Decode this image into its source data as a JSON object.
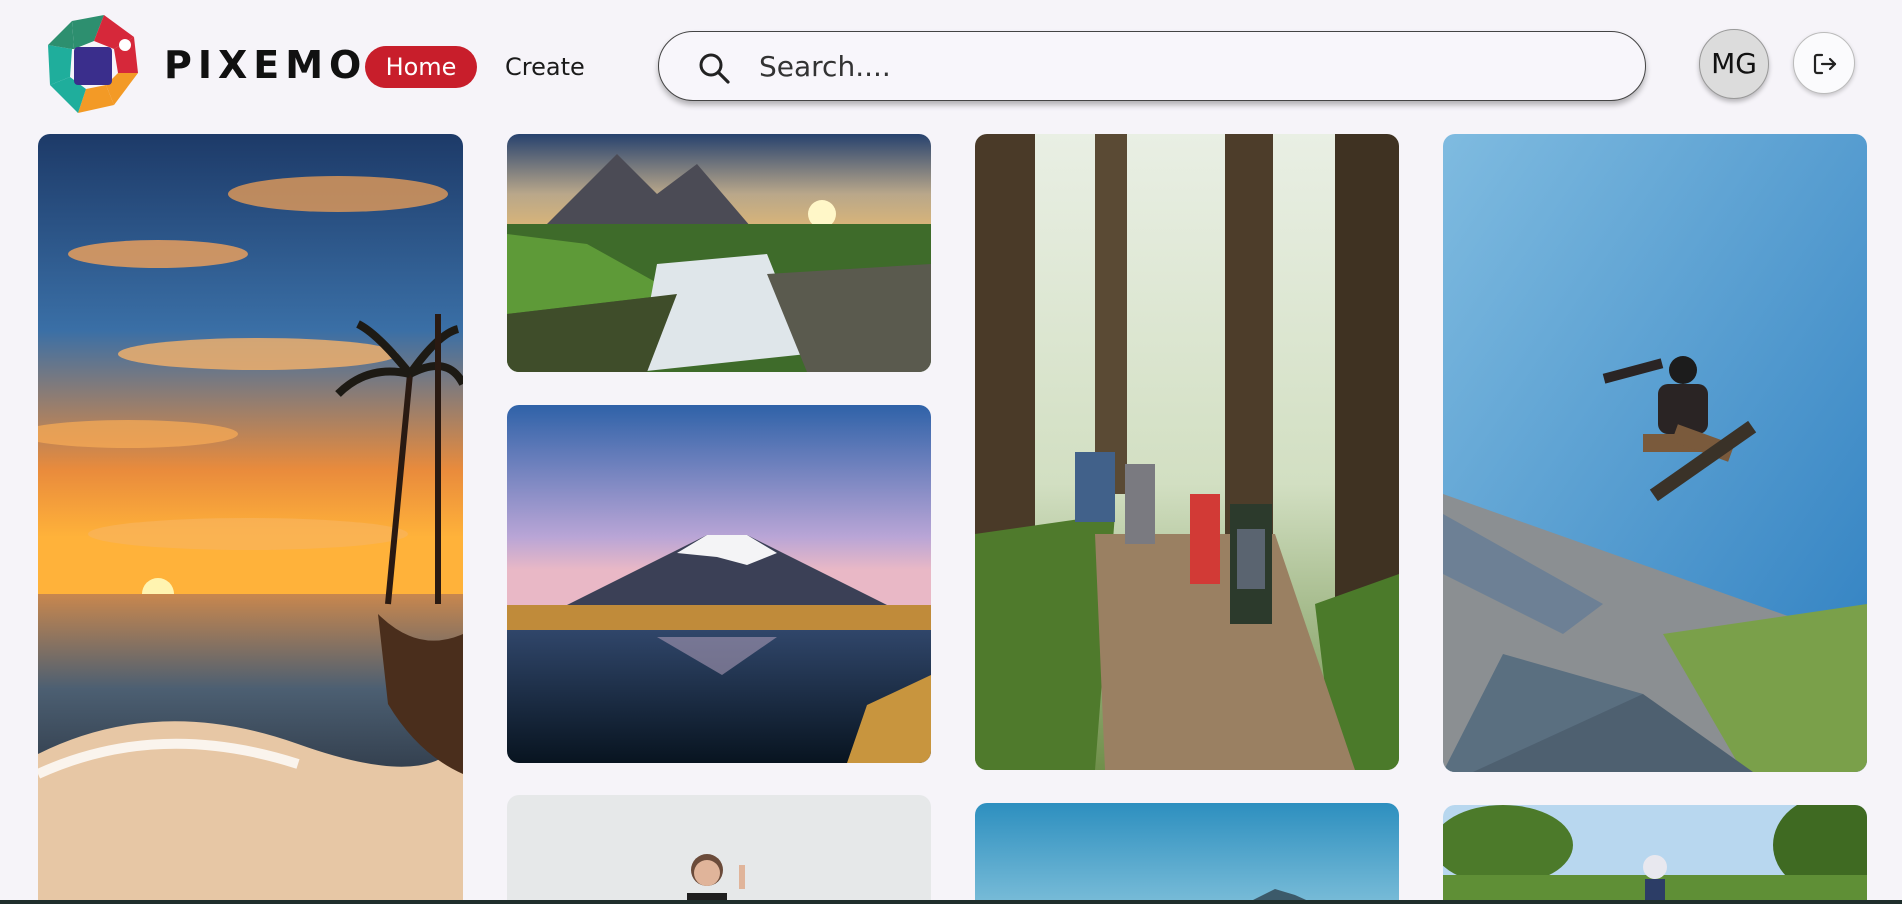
{
  "brand": {
    "name": "PIXEMO"
  },
  "nav": {
    "home_label": "Home",
    "create_label": "Create"
  },
  "search": {
    "placeholder": "Search...."
  },
  "user": {
    "initials": "MG"
  },
  "colors": {
    "accent": "#c81e2b",
    "background": "#f6f4f9"
  },
  "icons": {
    "search": "search-icon",
    "logout": "logout-icon",
    "logo": "pixemo-logo-icon"
  },
  "feed": [
    {
      "subject": "beach-sunset-with-palm-trees"
    },
    {
      "subject": "mountain-waterfall-at-sunrise"
    },
    {
      "subject": "snowcapped-volcano-reflected-in-lake"
    },
    {
      "subject": "hikers-walking-forest-trail"
    },
    {
      "subject": "skateboarder-jumping-over-skatepark"
    },
    {
      "subject": "person-smiling-pointing-up"
    },
    {
      "subject": "blue-sky-over-lake"
    },
    {
      "subject": "cyclist-in-park"
    }
  ]
}
